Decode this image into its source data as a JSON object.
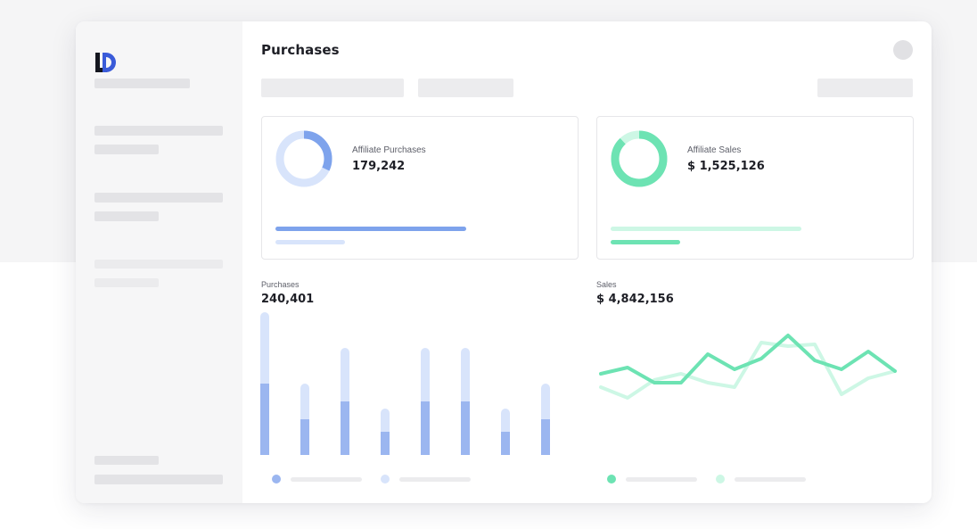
{
  "app": {
    "title": "Purchases",
    "logo": "LD-logo"
  },
  "colors": {
    "blue": "#7ea3ec",
    "blue_light": "#d8e4fb",
    "green": "#6de3b3",
    "green_light": "#cdf7e5",
    "placeholder": "#e3e3e6"
  },
  "cards": {
    "affiliate_purchases": {
      "label": "Affiliate Purchases",
      "value": "179,242",
      "progress_primary": 0.6,
      "progress_secondary": 0.22,
      "donut_fraction": 0.32
    },
    "affiliate_sales": {
      "label": "Affiliate Sales",
      "value": "$ 1,525,126",
      "progress_primary": 0.6,
      "progress_secondary": 0.22,
      "donut_fraction": 0.88
    }
  },
  "purchases_chart": {
    "label": "Purchases",
    "value": "240,401"
  },
  "sales_chart": {
    "label": "Sales",
    "value": "$ 4,842,156"
  },
  "chart_data": [
    {
      "type": "bar",
      "series": [
        {
          "values": [
            40,
            20,
            30,
            13,
            30,
            30,
            13,
            20
          ]
        },
        {
          "values": [
            80,
            40,
            60,
            26,
            60,
            60,
            26,
            40
          ]
        }
      ],
      "ylim": [
        0,
        80
      ],
      "grid": false
    },
    {
      "type": "line",
      "series": [
        {
          "values": [
            35,
            42,
            25,
            25,
            57,
            40,
            52,
            78,
            50,
            40,
            60,
            38
          ]
        },
        {
          "values": [
            20,
            8,
            28,
            35,
            25,
            20,
            70,
            66,
            68,
            12,
            30,
            38
          ]
        }
      ],
      "ylim": [
        0,
        100
      ],
      "grid": false
    }
  ]
}
